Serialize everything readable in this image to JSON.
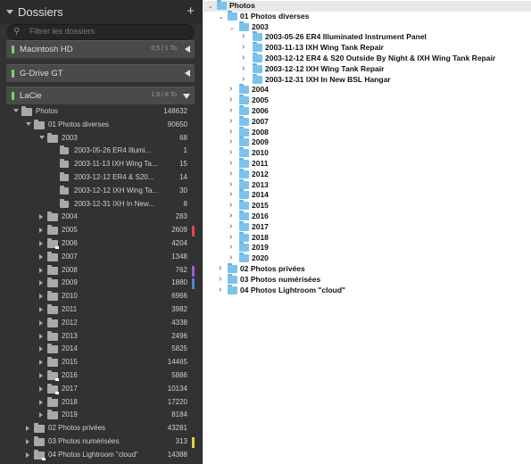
{
  "left_panel": {
    "title": "Dossiers",
    "add_label": "+",
    "search_placeholder": "Filtrer les dossiers",
    "volumes": [
      {
        "name": "Macintosh HD",
        "size": "0,5 / 1 To",
        "expanded": false
      },
      {
        "name": "G-Drive GT",
        "size": "",
        "expanded": false
      },
      {
        "name": "LaCie",
        "size": "1,8 / 8 To",
        "expanded": true
      }
    ],
    "tree": [
      {
        "label": "Photos",
        "count": "148632",
        "level": 0,
        "open": true
      },
      {
        "label": "01 Photos diverses",
        "count": "90650",
        "level": 1,
        "open": true
      },
      {
        "label": "2003",
        "count": "68",
        "level": 2,
        "open": true
      },
      {
        "label": "2003-05-26 ER4 Illumi...",
        "count": "1",
        "level": 3,
        "leaf": true
      },
      {
        "label": "2003-11-13 IXH Wing Ta...",
        "count": "15",
        "level": 3,
        "leaf": true
      },
      {
        "label": "2003-12-12 ER4 & S20...",
        "count": "14",
        "level": 3,
        "leaf": true
      },
      {
        "label": "2003-12-12 IXH Wing Ta...",
        "count": "30",
        "level": 3,
        "leaf": true
      },
      {
        "label": "2003-12-31 IXH In New...",
        "count": "8",
        "level": 3,
        "leaf": true
      },
      {
        "label": "2004",
        "count": "283",
        "level": 2
      },
      {
        "label": "2005",
        "count": "2609",
        "level": 2,
        "mark": "#e04848"
      },
      {
        "label": "2006",
        "count": "4204",
        "level": 2,
        "badge": true
      },
      {
        "label": "2007",
        "count": "1348",
        "level": 2
      },
      {
        "label": "2008",
        "count": "762",
        "level": 2,
        "mark": "#9a5fd6"
      },
      {
        "label": "2009",
        "count": "1880",
        "level": 2,
        "mark": "#4d86d8"
      },
      {
        "label": "2010",
        "count": "6966",
        "level": 2
      },
      {
        "label": "2011",
        "count": "3982",
        "level": 2
      },
      {
        "label": "2012",
        "count": "4338",
        "level": 2
      },
      {
        "label": "2013",
        "count": "2496",
        "level": 2
      },
      {
        "label": "2014",
        "count": "5825",
        "level": 2
      },
      {
        "label": "2015",
        "count": "14465",
        "level": 2
      },
      {
        "label": "2016",
        "count": "5886",
        "level": 2,
        "badge": true
      },
      {
        "label": "2017",
        "count": "10134",
        "level": 2,
        "badge": true
      },
      {
        "label": "2018",
        "count": "17220",
        "level": 2
      },
      {
        "label": "2019",
        "count": "8184",
        "level": 2
      },
      {
        "label": "02 Photos privées",
        "count": "43281",
        "level": 1
      },
      {
        "label": "03 Photos numérisées",
        "count": "313",
        "level": 1,
        "mark": "#e3d23a"
      },
      {
        "label": "04 Photos Lightroom \"cloud\"",
        "count": "14388",
        "level": 1,
        "badge": true
      }
    ]
  },
  "right_panel": {
    "rows": [
      {
        "label": "Photos",
        "level": 0,
        "open": true,
        "header": true
      },
      {
        "label": "01 Photos diverses",
        "level": 1,
        "open": true
      },
      {
        "label": "2003",
        "level": 2,
        "open": true
      },
      {
        "label": "2003-05-26 ER4 Illuminated Instrument Panel",
        "level": 3
      },
      {
        "label": "2003-11-13 IXH Wing Tank Repair",
        "level": 3
      },
      {
        "label": "2003-12-12 ER4 & S20 Outside By Night & IXH Wing Tank Repair",
        "level": 3
      },
      {
        "label": "2003-12-12 IXH Wing Tank Repair",
        "level": 3
      },
      {
        "label": "2003-12-31 IXH In New BSL Hangar",
        "level": 3
      },
      {
        "label": "2004",
        "level": 2
      },
      {
        "label": "2005",
        "level": 2
      },
      {
        "label": "2006",
        "level": 2
      },
      {
        "label": "2007",
        "level": 2
      },
      {
        "label": "2008",
        "level": 2
      },
      {
        "label": "2009",
        "level": 2
      },
      {
        "label": "2010",
        "level": 2
      },
      {
        "label": "2011",
        "level": 2
      },
      {
        "label": "2012",
        "level": 2
      },
      {
        "label": "2013",
        "level": 2
      },
      {
        "label": "2014",
        "level": 2
      },
      {
        "label": "2015",
        "level": 2
      },
      {
        "label": "2016",
        "level": 2
      },
      {
        "label": "2017",
        "level": 2
      },
      {
        "label": "2018",
        "level": 2
      },
      {
        "label": "2019",
        "level": 2
      },
      {
        "label": "2020",
        "level": 2
      },
      {
        "label": "02 Photos privées",
        "level": 1
      },
      {
        "label": "03 Photos numérisées",
        "level": 1
      },
      {
        "label": "04 Photos Lightroom \"cloud\"",
        "level": 1
      }
    ]
  }
}
